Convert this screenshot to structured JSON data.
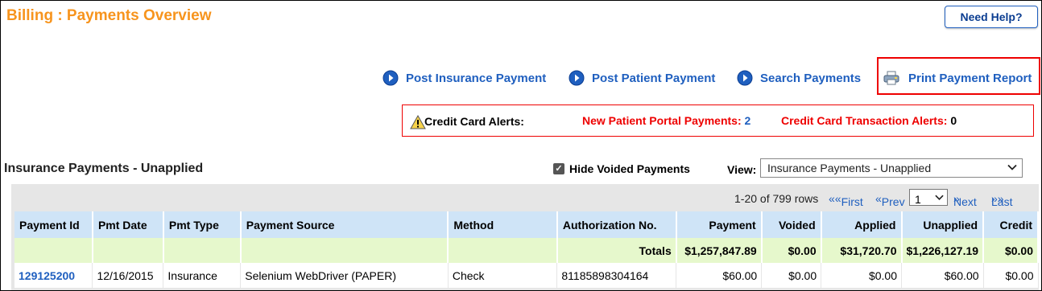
{
  "page": {
    "title": "Billing : Payments Overview",
    "help_label": "Need Help?"
  },
  "actions": {
    "post_insurance": "Post Insurance Payment",
    "post_patient": "Post Patient Payment",
    "search": "Search Payments",
    "print_report": "Print Payment Report"
  },
  "alerts": {
    "label": "Credit Card Alerts:",
    "portal_label": "New Patient Portal Payments:",
    "portal_count": "2",
    "txn_label": "Credit Card Transaction Alerts:",
    "txn_count": "0"
  },
  "section": {
    "title": "Insurance Payments - Unapplied",
    "hide_voided_label": "Hide Voided Payments",
    "hide_voided_checked": true,
    "view_label": "View:",
    "view_value": "Insurance Payments - Unapplied"
  },
  "pager": {
    "count": "1-20 of 799 rows",
    "first": "First",
    "prev": "Prev",
    "page": "1",
    "next": "Next",
    "last": "Last"
  },
  "table": {
    "headers": [
      "Payment Id",
      "Pmt Date",
      "Pmt Type",
      "Payment Source",
      "Method",
      "Authorization No.",
      "Payment",
      "Voided",
      "Applied",
      "Unapplied",
      "Credit"
    ],
    "totals": {
      "label": "Totals",
      "payment": "$1,257,847.89",
      "voided": "$0.00",
      "applied": "$31,720.70",
      "unapplied": "$1,226,127.19",
      "credit": "$0.00"
    },
    "rows": [
      {
        "payment_id": "129125200",
        "pmt_date": "12/16/2015",
        "pmt_type": "Insurance",
        "source": "Selenium WebDriver (PAPER)",
        "method": "Check",
        "auth_no": "81185898304164",
        "payment": "$60.00",
        "voided": "$0.00",
        "applied": "$0.00",
        "unapplied": "$60.00",
        "credit": "$0.00"
      }
    ]
  },
  "colors": {
    "title_orange": "#f7941d",
    "link_blue": "#1f5fbf",
    "alert_red": "#e00",
    "header_blue": "#cfe4f7",
    "totals_green": "#e6f8cc"
  }
}
